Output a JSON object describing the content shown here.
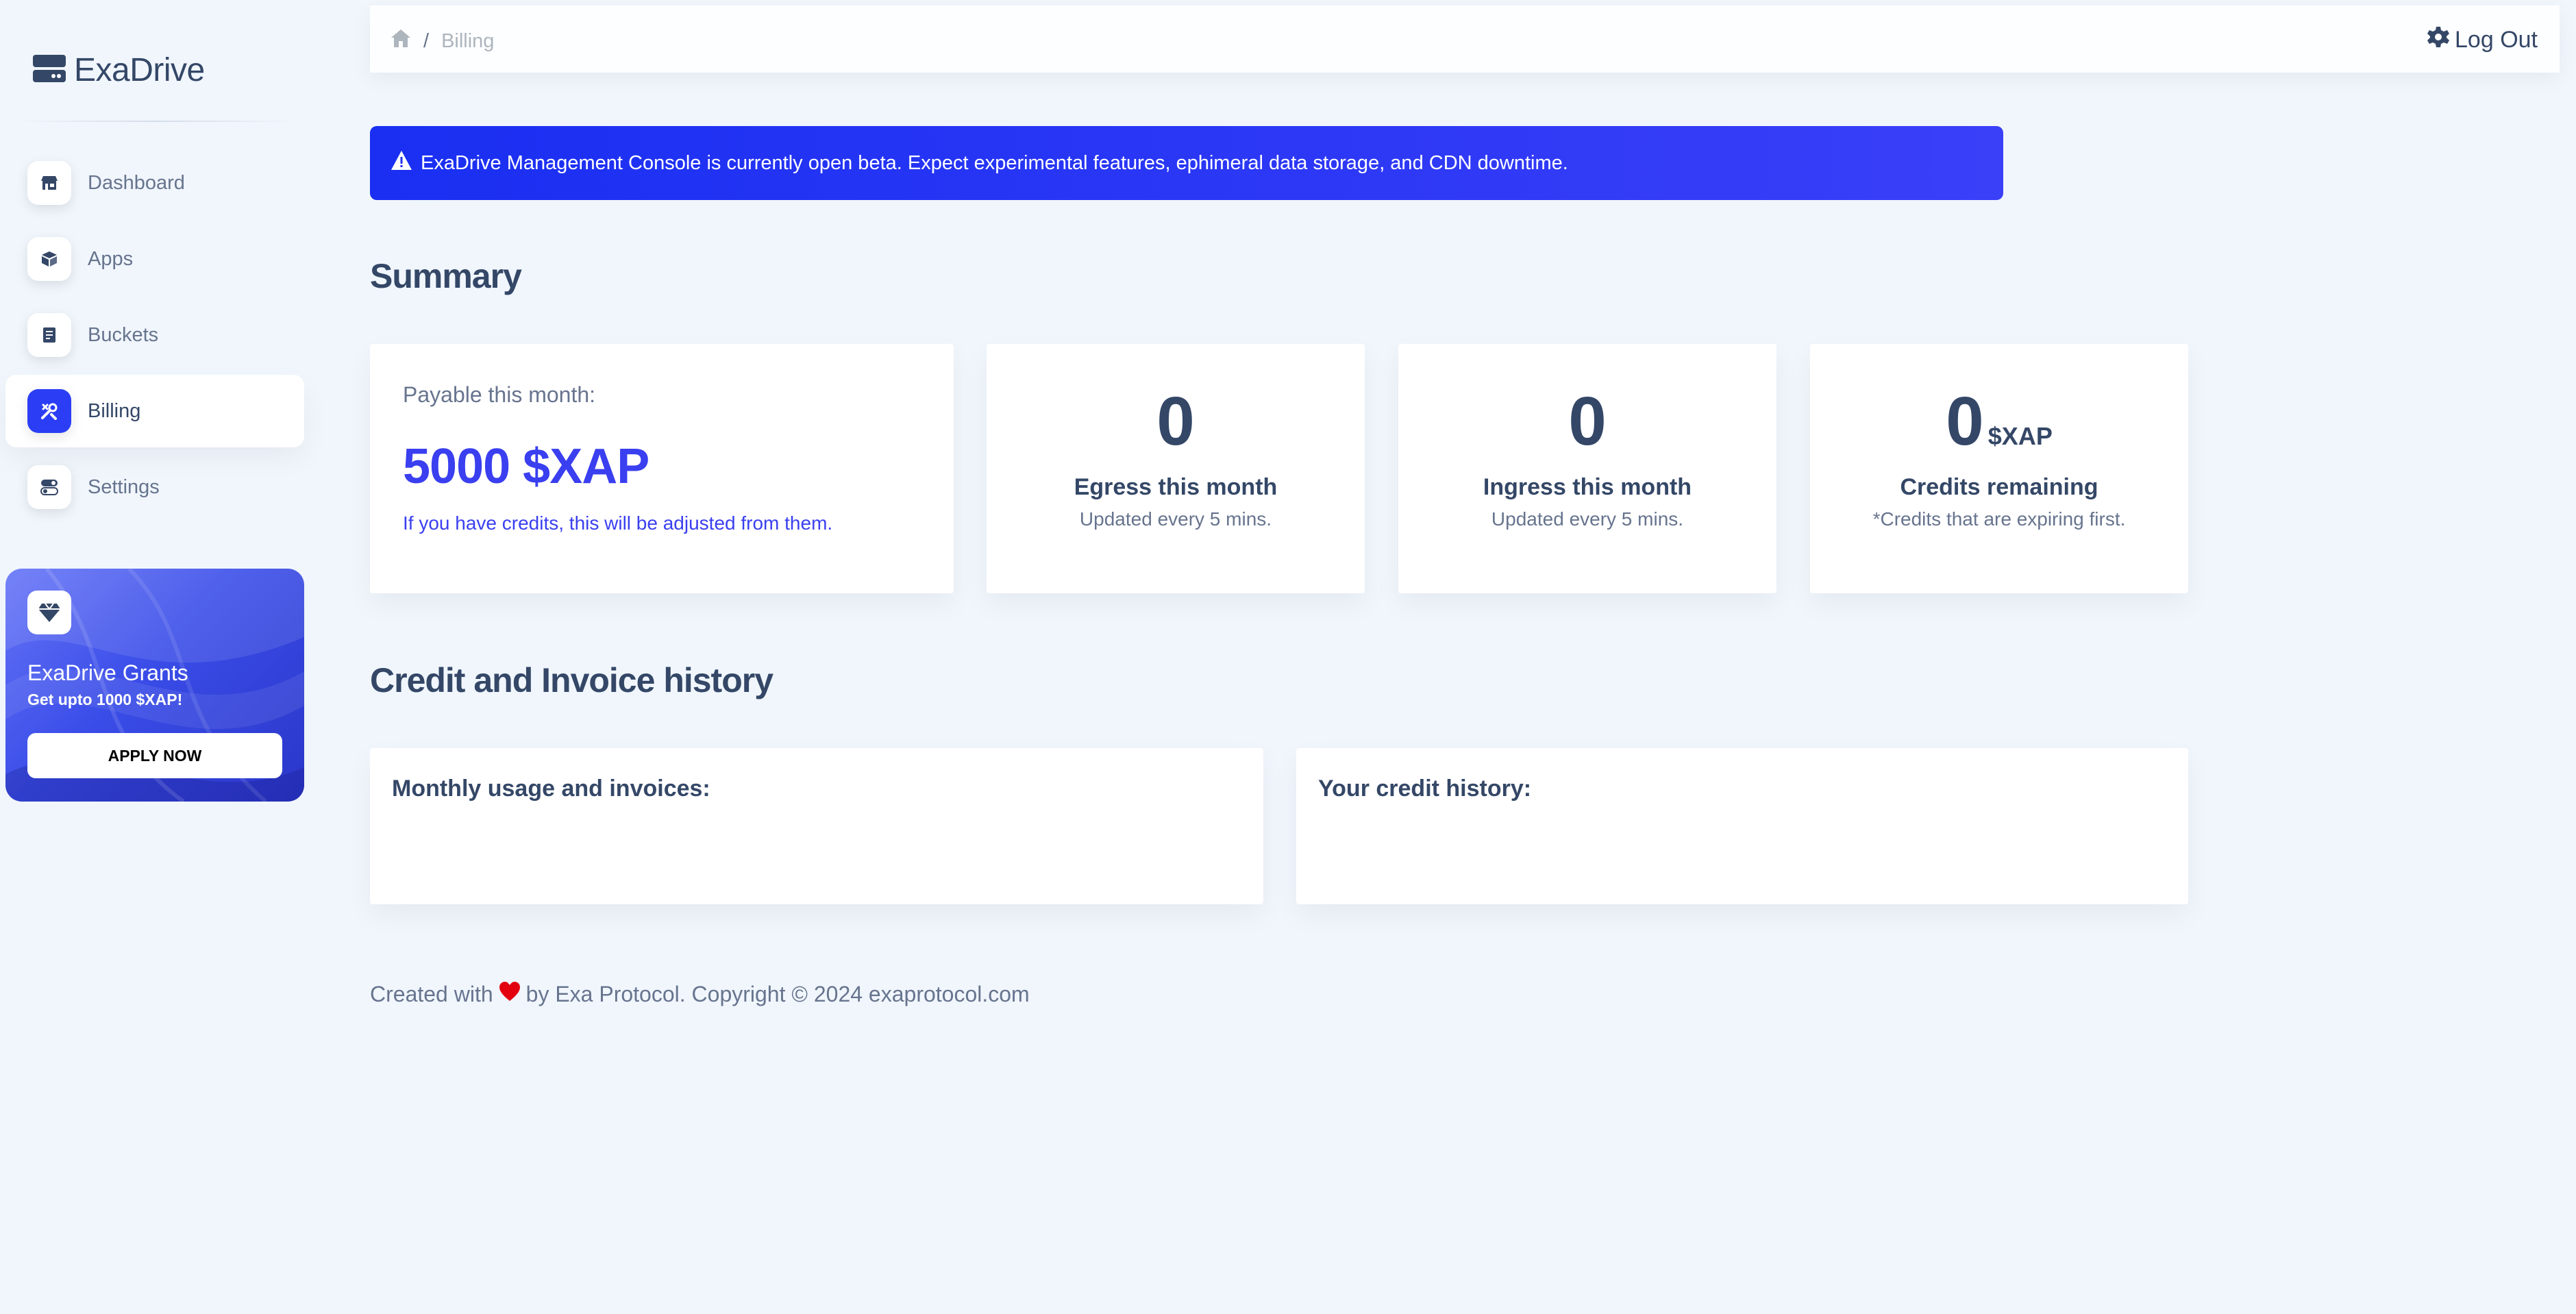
{
  "app": {
    "name": "ExaDrive"
  },
  "sidebar": {
    "items": [
      {
        "label": "Dashboard",
        "icon": "shop-icon",
        "active": false
      },
      {
        "label": "Apps",
        "icon": "box-icon",
        "active": false
      },
      {
        "label": "Buckets",
        "icon": "document-icon",
        "active": false
      },
      {
        "label": "Billing",
        "icon": "tools-icon",
        "active": true
      },
      {
        "label": "Settings",
        "icon": "toggle-icon",
        "active": false
      }
    ],
    "grant": {
      "title": "ExaDrive Grants",
      "subtitle": "Get upto 1000 $XAP!",
      "button": "APPLY NOW",
      "icon": "diamond-icon"
    }
  },
  "topbar": {
    "breadcrumb": {
      "home_icon": "home-icon",
      "separator": "/",
      "current": "Billing"
    },
    "logout_label": "Log Out",
    "logout_icon": "gear-icon"
  },
  "alert": {
    "icon": "warning-icon",
    "text": "ExaDrive Management Console is currently open beta. Expect experimental features, ephimeral data storage, and CDN downtime."
  },
  "summary": {
    "title": "Summary",
    "payable": {
      "label": "Payable this month:",
      "value": "5000 $XAP",
      "note": "If you have credits, this will be adjusted from them."
    },
    "egress": {
      "value": "0",
      "title": "Egress this month",
      "sub": "Updated every 5 mins."
    },
    "ingress": {
      "value": "0",
      "title": "Ingress this month",
      "sub": "Updated every 5 mins."
    },
    "credits": {
      "value": "0",
      "unit": "$XAP",
      "title": "Credits remaining",
      "sub": "*Credits that are expiring first."
    }
  },
  "history": {
    "title": "Credit and Invoice history",
    "monthly_title": "Monthly usage and invoices:",
    "credit_title": "Your credit history:"
  },
  "footer": {
    "before": "Created with",
    "after": "by Exa Protocol. Copyright © 2024 exaprotocol.com",
    "heart_icon": "heart-icon",
    "heart_color": "#e3000f"
  },
  "colors": {
    "accent": "#2b3ef5",
    "text": "#344767",
    "muted": "#67748e",
    "background": "#f0f6fc"
  }
}
